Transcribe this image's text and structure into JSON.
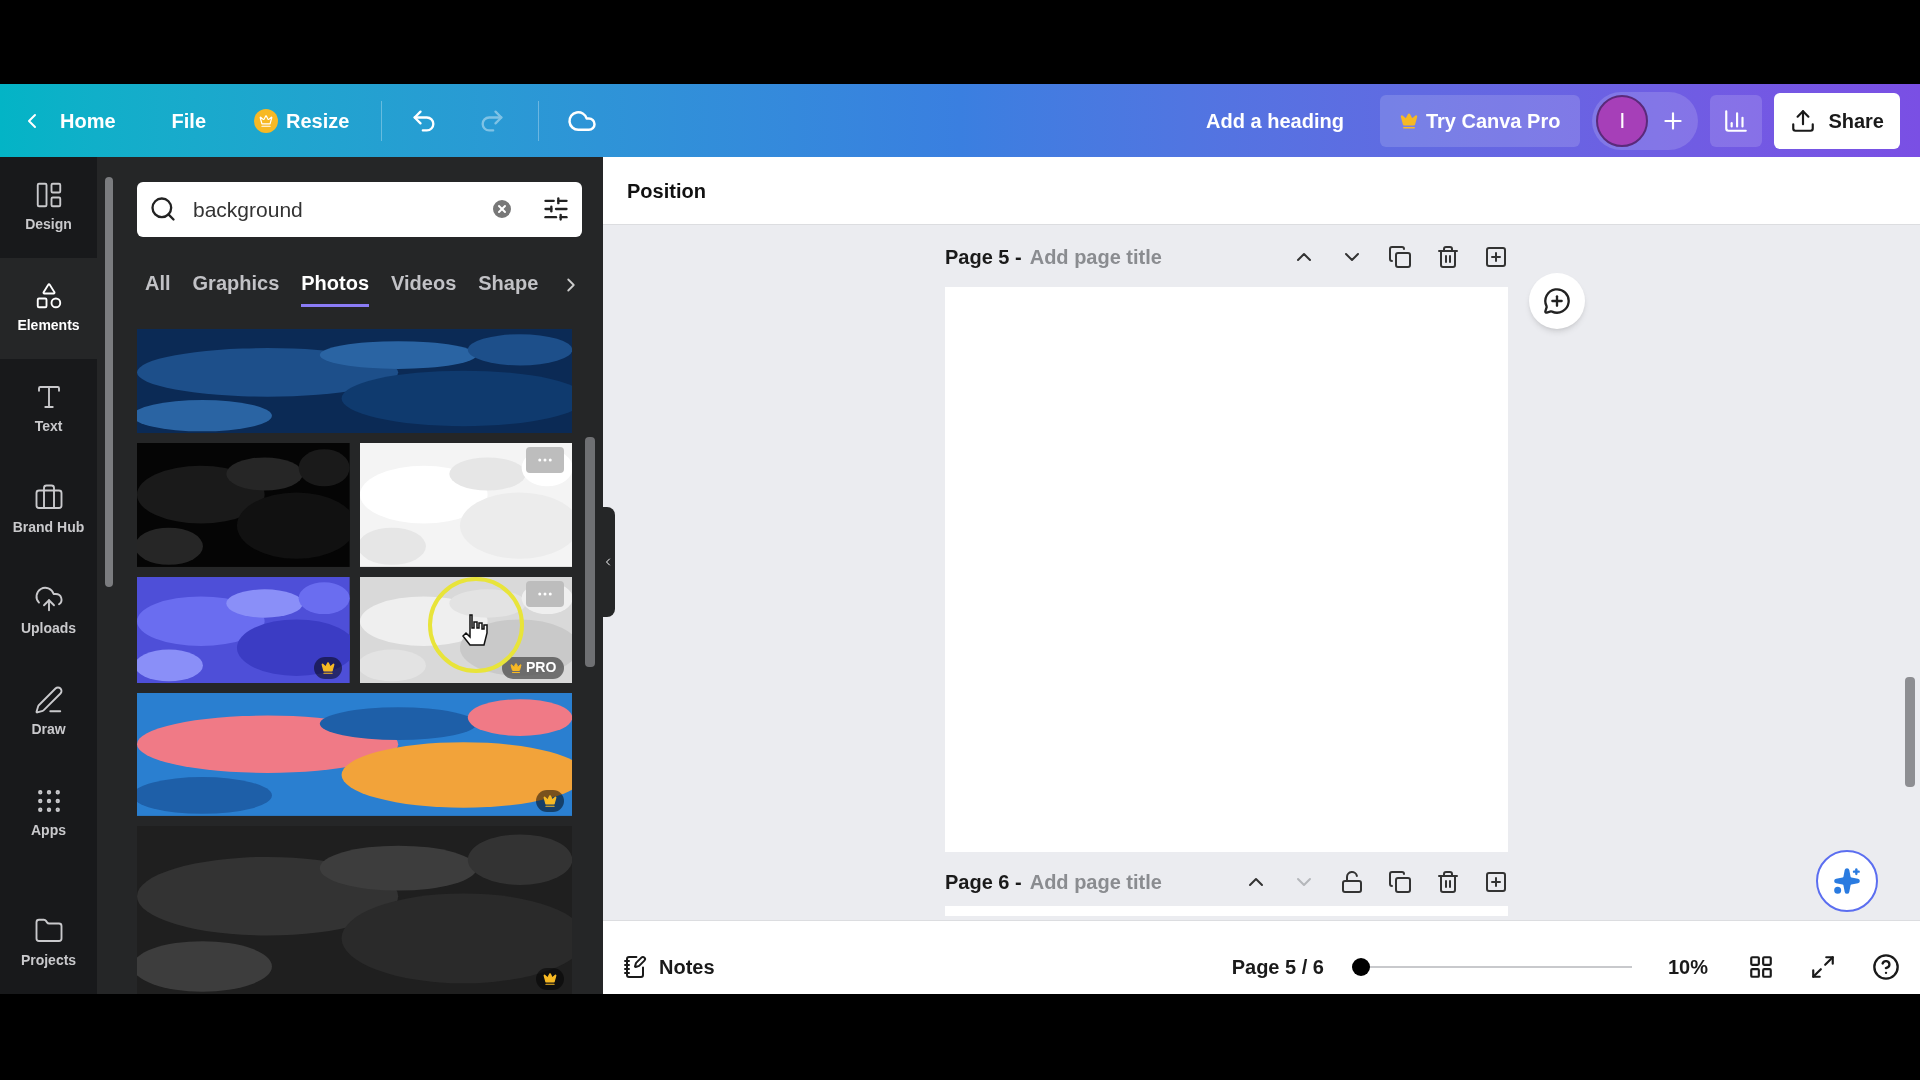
{
  "topbar": {
    "back": "Home",
    "menu": [
      "File"
    ],
    "resize": "Resize",
    "redo_disabled": true,
    "title": "Add a heading",
    "pro": "Try Canva Pro",
    "avatar": "I",
    "share": "Share"
  },
  "rail": [
    {
      "label": "Design",
      "selected": false
    },
    {
      "label": "Elements",
      "selected": true
    },
    {
      "label": "Text",
      "selected": false
    },
    {
      "label": "Brand Hub",
      "selected": false
    },
    {
      "label": "Uploads",
      "selected": false
    },
    {
      "label": "Draw",
      "selected": false
    },
    {
      "label": "Apps",
      "selected": false
    },
    {
      "label": "Projects",
      "selected": false
    }
  ],
  "search": {
    "value": "background"
  },
  "tabs": [
    {
      "label": "All",
      "selected": false
    },
    {
      "label": "Graphics",
      "selected": false
    },
    {
      "label": "Photos",
      "selected": true
    },
    {
      "label": "Videos",
      "selected": false
    },
    {
      "label": "Shape",
      "selected": false
    }
  ],
  "photo_rows": [
    [
      {
        "kind": "picture",
        "premium": false,
        "menu": false
      }
    ],
    [
      {
        "kind": "picture",
        "premium": false,
        "menu": false
      },
      {
        "kind": "picture",
        "premium": false,
        "menu": true
      }
    ],
    [
      {
        "kind": "picture",
        "premium": true,
        "menu": false
      },
      {
        "kind": "picture",
        "premium": true,
        "menu": true,
        "badge": "PRO"
      }
    ],
    [
      {
        "kind": "picture",
        "premium": true,
        "menu": false
      }
    ],
    [
      {
        "kind": "picture",
        "premium": true,
        "menu": false
      }
    ]
  ],
  "toolbar": {
    "label": "Position"
  },
  "pages": [
    {
      "name": "Page 5 -",
      "title_placeholder": "Add page title",
      "down_disabled": false,
      "lock": false
    },
    {
      "name": "Page 6 -",
      "title_placeholder": "Add page title",
      "down_disabled": true,
      "lock": true
    }
  ],
  "footer": {
    "notes": "Notes",
    "page_indicator": "Page 5 / 6",
    "zoom": {
      "level": 0
    },
    "zoom_reading": "10%"
  }
}
